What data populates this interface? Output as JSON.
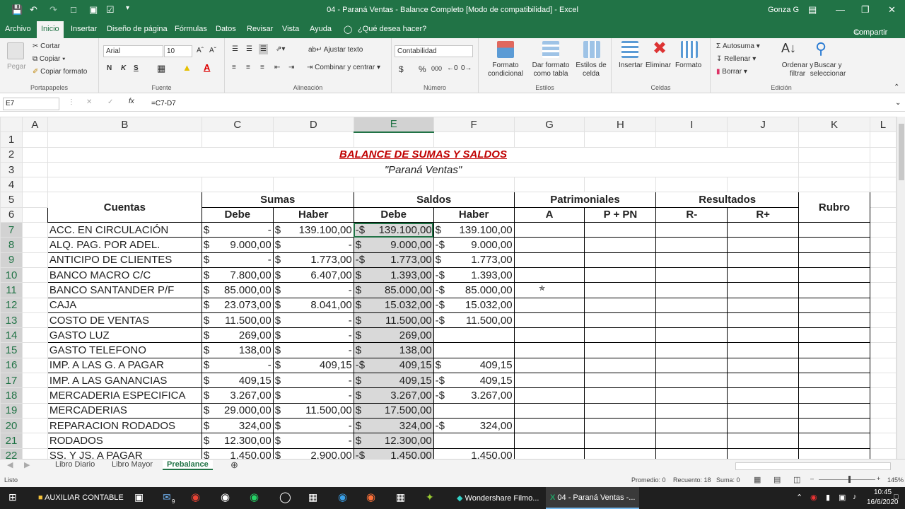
{
  "window": {
    "title": "04 - Paraná Ventas - Balance Completo  [Modo de compatibilidad]  -  Excel",
    "user": "Gonza G"
  },
  "tabs": [
    "Archivo",
    "Inicio",
    "Insertar",
    "Diseño de página",
    "Fórmulas",
    "Datos",
    "Revisar",
    "Vista",
    "Ayuda",
    "¿Qué desea hacer?"
  ],
  "share": "Compartir",
  "ribbon": {
    "portapapeles": {
      "paste": "Pegar",
      "cut": "Cortar",
      "copy": "Copiar",
      "format_copy": "Copiar formato",
      "label": "Portapapeles"
    },
    "fuente": {
      "font": "Arial",
      "size": "10",
      "label": "Fuente",
      "bold": "N",
      "italic": "K",
      "underline": "S"
    },
    "alineacion": {
      "wrap": "Ajustar texto",
      "merge": "Combinar y centrar",
      "label": "Alineación"
    },
    "numero": {
      "format": "Contabilidad",
      "currency": "$",
      "percent": "%",
      "thousands": "000",
      "label": "Número"
    },
    "estilos": {
      "cond": "Formato condicional",
      "table": "Dar formato como tabla",
      "cell": "Estilos de celda",
      "label": "Estilos"
    },
    "celdas": {
      "insert": "Insertar",
      "delete": "Eliminar",
      "format": "Formato",
      "label": "Celdas"
    },
    "edicion": {
      "autosum": "Autosuma",
      "fill": "Rellenar",
      "clear": "Borrar",
      "sort": "Ordenar y filtrar",
      "find": "Buscar y seleccionar",
      "label": "Edición"
    }
  },
  "formula_bar": {
    "name_box": "E7",
    "formula": "=C7-D7"
  },
  "columns": [
    "A",
    "B",
    "C",
    "D",
    "E",
    "F",
    "G",
    "H",
    "I",
    "J",
    "K",
    "L"
  ],
  "row_numbers": [
    "1",
    "2",
    "3",
    "4",
    "5",
    "6",
    "7",
    "8",
    "9",
    "10",
    "11",
    "12",
    "13",
    "14",
    "15",
    "16",
    "17",
    "18",
    "19",
    "20",
    "21",
    "22"
  ],
  "sheet_title": "BALANCE DE SUMAS Y SALDOS",
  "sheet_subtitle": "\"Paraná Ventas\"",
  "headers": {
    "cuentas": "Cuentas",
    "sumas": "Sumas",
    "saldos": "Saldos",
    "patrimoniales": "Patrimoniales",
    "resultados": "Resultados",
    "rubro": "Rubro",
    "debe": "Debe",
    "haber": "Haber",
    "a": "A",
    "ppn": "P + PN",
    "rminus": "R-",
    "rplus": "R+"
  },
  "rows": [
    {
      "cuenta": "ACC. EN  CIRCULACIÓN",
      "c": [
        "$",
        "-"
      ],
      "d": [
        "$",
        "139.100,00"
      ],
      "e": [
        "-$",
        "139.100,00"
      ],
      "f": [
        "$",
        "139.100,00"
      ]
    },
    {
      "cuenta": "ALQ. PAG. POR ADEL.",
      "c": [
        "$",
        "9.000,00"
      ],
      "d": [
        "$",
        "-"
      ],
      "e": [
        "$",
        "9.000,00"
      ],
      "f": [
        "-$",
        "9.000,00"
      ]
    },
    {
      "cuenta": "ANTICIPO DE CLIENTES",
      "c": [
        "$",
        "-"
      ],
      "d": [
        "$",
        "1.773,00"
      ],
      "e": [
        "-$",
        "1.773,00"
      ],
      "f": [
        "$",
        "1.773,00"
      ]
    },
    {
      "cuenta": "BANCO MACRO C/C",
      "c": [
        "$",
        "7.800,00"
      ],
      "d": [
        "$",
        "6.407,00"
      ],
      "e": [
        "$",
        "1.393,00"
      ],
      "f": [
        "-$",
        "1.393,00"
      ]
    },
    {
      "cuenta": "BANCO SANTANDER P/F",
      "c": [
        "$",
        "85.000,00"
      ],
      "d": [
        "$",
        "-"
      ],
      "e": [
        "$",
        "85.000,00"
      ],
      "f": [
        "-$",
        "85.000,00"
      ]
    },
    {
      "cuenta": "CAJA",
      "c": [
        "$",
        "23.073,00"
      ],
      "d": [
        "$",
        "8.041,00"
      ],
      "e": [
        "$",
        "15.032,00"
      ],
      "f": [
        "-$",
        "15.032,00"
      ]
    },
    {
      "cuenta": "COSTO DE VENTAS",
      "c": [
        "$",
        "11.500,00"
      ],
      "d": [
        "$",
        "-"
      ],
      "e": [
        "$",
        "11.500,00"
      ],
      "f": [
        "-$",
        "11.500,00"
      ]
    },
    {
      "cuenta": "GASTO LUZ",
      "c": [
        "$",
        "269,00"
      ],
      "d": [
        "$",
        "-"
      ],
      "e": [
        "$",
        "269,00"
      ],
      "f": [
        "",
        ""
      ]
    },
    {
      "cuenta": "GASTO TELEFONO",
      "c": [
        "$",
        "138,00"
      ],
      "d": [
        "$",
        "-"
      ],
      "e": [
        "$",
        "138,00"
      ],
      "f": [
        "",
        ""
      ]
    },
    {
      "cuenta": "IMP. A LAS G. A PAGAR",
      "c": [
        "$",
        "-"
      ],
      "d": [
        "$",
        "409,15"
      ],
      "e": [
        "-$",
        "409,15"
      ],
      "f": [
        "$",
        "409,15"
      ]
    },
    {
      "cuenta": "IMP. A LAS GANANCIAS",
      "c": [
        "$",
        "409,15"
      ],
      "d": [
        "$",
        "-"
      ],
      "e": [
        "$",
        "409,15"
      ],
      "f": [
        "-$",
        "409,15"
      ]
    },
    {
      "cuenta": "MERCADERIA ESPECIFICA",
      "c": [
        "$",
        "3.267,00"
      ],
      "d": [
        "$",
        "-"
      ],
      "e": [
        "$",
        "3.267,00"
      ],
      "f": [
        "-$",
        "3.267,00"
      ]
    },
    {
      "cuenta": "MERCADERIAS",
      "c": [
        "$",
        "29.000,00"
      ],
      "d": [
        "$",
        "11.500,00"
      ],
      "e": [
        "$",
        "17.500,00"
      ],
      "f": [
        "",
        ""
      ]
    },
    {
      "cuenta": "REPARACION RODADOS",
      "c": [
        "$",
        "324,00"
      ],
      "d": [
        "$",
        "-"
      ],
      "e": [
        "$",
        "324,00"
      ],
      "f": [
        "-$",
        "324,00"
      ]
    },
    {
      "cuenta": "RODADOS",
      "c": [
        "$",
        "12.300,00"
      ],
      "d": [
        "$",
        "-"
      ],
      "e": [
        "$",
        "12.300,00"
      ],
      "f": [
        "",
        ""
      ]
    },
    {
      "cuenta": "SS. Y JS. A PAGAR",
      "c": [
        "$",
        "1.450,00"
      ],
      "d": [
        "$",
        "2.900,00"
      ],
      "e": [
        "-$",
        "1.450,00"
      ],
      "f": [
        "",
        "1.450,00"
      ]
    }
  ],
  "sheet_tabs": [
    "Libro Diario",
    "Libro Mayor",
    "Prebalance"
  ],
  "status": {
    "ready": "Listo",
    "avg": "Promedio: 0",
    "count": "Recuento: 18",
    "sum": "Suma: 0",
    "zoom": "145%"
  },
  "taskbar": {
    "folder": "AUXILIAR CONTABLE",
    "app1": "Wondershare Filmo...",
    "app2": "04 - Paraná Ventas -...",
    "time": "10:45",
    "date": "16/6/2020",
    "badge": "9"
  }
}
